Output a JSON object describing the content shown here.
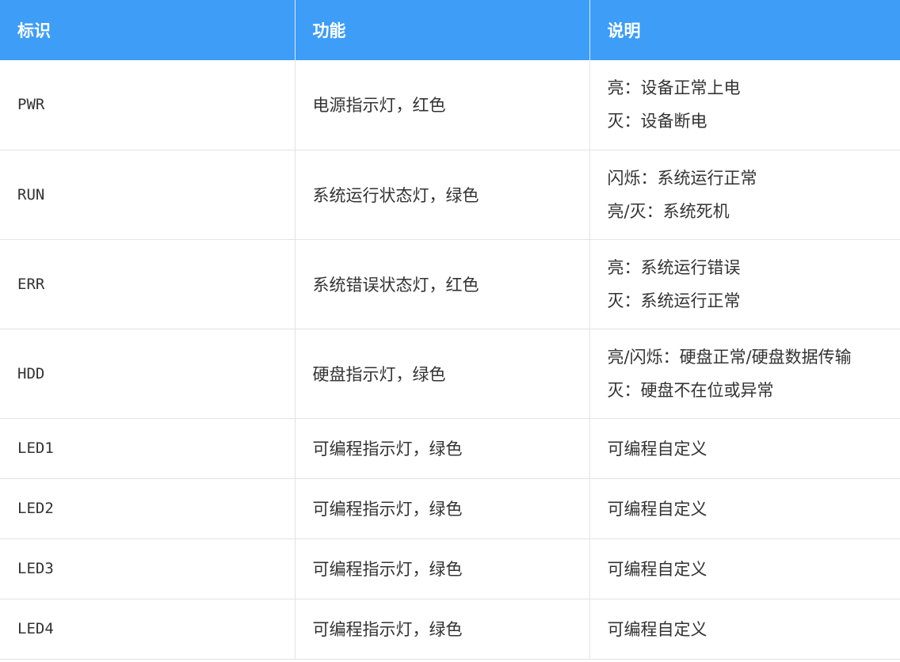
{
  "header": {
    "col1": "标识",
    "col2": "功能",
    "col3": "说明"
  },
  "rows": [
    {
      "id": "PWR",
      "function": "电源指示灯，红色",
      "desc_line1": "亮：设备正常上电",
      "desc_line2": "灭：设备断电"
    },
    {
      "id": "RUN",
      "function": "系统运行状态灯，绿色",
      "desc_line1": "闪烁：系统运行正常",
      "desc_line2": "亮/灭：系统死机"
    },
    {
      "id": "ERR",
      "function": "系统错误状态灯，红色",
      "desc_line1": "亮：系统运行错误",
      "desc_line2": "灭：系统运行正常"
    },
    {
      "id": "HDD",
      "function": "硬盘指示灯，绿色",
      "desc_line1": "亮/闪烁：硬盘正常/硬盘数据传输",
      "desc_line2": "灭：硬盘不在位或异常"
    },
    {
      "id": "LED1",
      "function": "可编程指示灯，绿色",
      "desc_line1": "可编程自定义"
    },
    {
      "id": "LED2",
      "function": "可编程指示灯，绿色",
      "desc_line1": "可编程自定义"
    },
    {
      "id": "LED3",
      "function": "可编程指示灯，绿色",
      "desc_line1": "可编程自定义"
    },
    {
      "id": "LED4",
      "function": "可编程指示灯，绿色",
      "desc_line1": "可编程自定义"
    }
  ],
  "colors": {
    "header_bg": "#3d9df7",
    "header_text": "#ffffff",
    "body_text": "#333333",
    "border": "#e3e3e3"
  }
}
